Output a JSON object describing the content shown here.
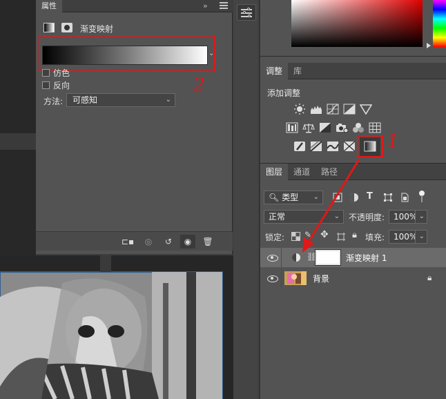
{
  "properties": {
    "tab_label": "属性",
    "collapse_glyph": "»",
    "title": "渐变映射",
    "dither_label": "仿色",
    "reverse_label": "反向",
    "method_label": "方法:",
    "method_value": "可感知"
  },
  "adjustments": {
    "tabs": [
      "调整",
      "库"
    ],
    "add_label": "添加调整"
  },
  "layers": {
    "tabs": [
      "图层",
      "通道",
      "路径"
    ],
    "filter_value": "类型",
    "blend_mode": "正常",
    "opacity_label": "不透明度:",
    "opacity_value": "100%",
    "lock_label": "锁定:",
    "fill_label": "填充:",
    "fill_value": "100%",
    "rows": [
      {
        "name": "渐变映射 1"
      },
      {
        "name": "背景"
      }
    ]
  },
  "annotations": {
    "label_1": "1",
    "label_2": "2",
    "color": "#e01818"
  },
  "colors": {
    "panel": "#535353",
    "panel_dark": "#3f3f3f",
    "accent_red": "#e01818"
  }
}
